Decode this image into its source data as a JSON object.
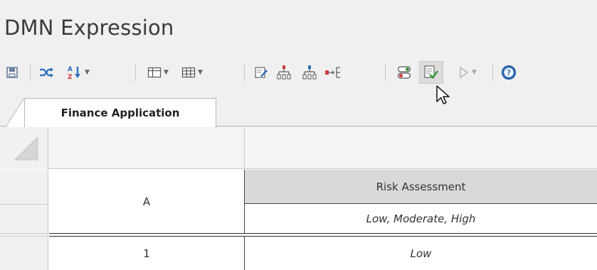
{
  "title": "DMN Expression",
  "toolbar": {
    "buttons": [
      "save-icon",
      "shuffle-icon",
      "sort-az-icon",
      "insert-column-icon",
      "table-grid-icon",
      "edit-icon",
      "add-child-node-icon",
      "add-sibling-node-icon",
      "connect-icon",
      "toggle-icon",
      "validate-icon",
      "run-icon",
      "help-icon"
    ]
  },
  "tab": {
    "label": "Finance Application"
  },
  "table": {
    "input_column": {
      "label": "A"
    },
    "output_column": {
      "label": "Risk Assessment",
      "allowed_values": "Low, Moderate, High"
    },
    "rows": [
      {
        "number": "1",
        "value": "Low"
      }
    ]
  },
  "colors": {
    "accent_blue": "#2e6ebd",
    "green": "#3a9a3a",
    "red": "#d23a3a"
  }
}
